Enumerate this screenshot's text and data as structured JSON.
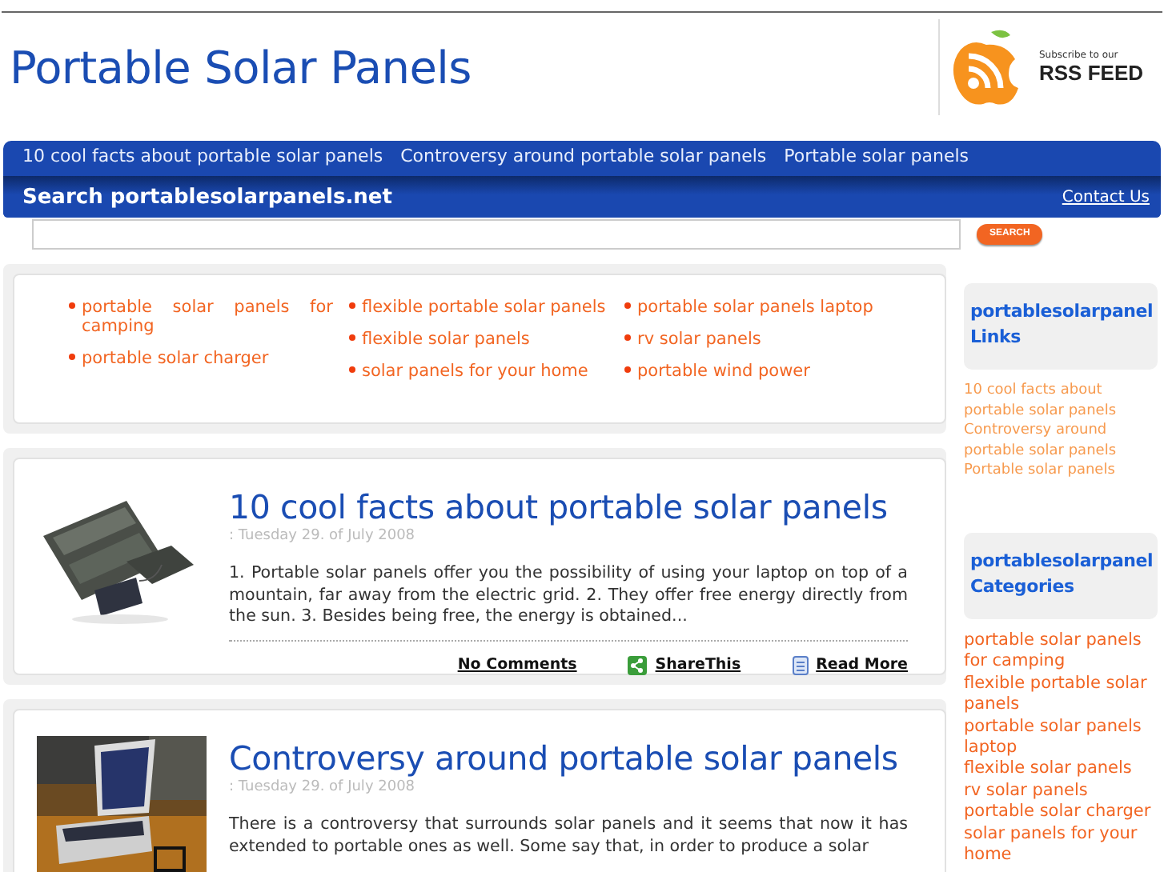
{
  "header": {
    "title": "Portable Solar Panels",
    "rss_small": "Subscribe to our",
    "rss_big": "RSS FEED"
  },
  "nav": {
    "links": [
      "10 cool facts about portable solar panels",
      "Controversy around portable solar panels",
      "Portable solar panels"
    ]
  },
  "search": {
    "label": "Search portablesolarpanels.net",
    "contact": "Contact Us",
    "button": "SEARCH"
  },
  "category_columns": [
    {
      "items": [
        "portable solar panels for camping",
        "portable solar charger"
      ]
    },
    {
      "items": [
        "flexible portable solar panels",
        "flexible solar panels",
        "solar panels for your home"
      ]
    },
    {
      "items": [
        "portable solar panels laptop",
        "rv solar panels",
        "portable wind power"
      ]
    }
  ],
  "posts": [
    {
      "title": "10 cool facts about portable solar panels",
      "date": ": Tuesday 29. of July 2008",
      "excerpt": "1. Portable solar panels offer you the possibility of using your laptop on top of a mountain, far away from the electric grid. 2. They offer free energy directly from the sun. 3. Besides being free, the energy is obtained...",
      "footer": {
        "comments": "No Comments",
        "share": "ShareThis",
        "read_more": "Read More"
      }
    },
    {
      "title": "Controversy around portable solar panels",
      "date": ": Tuesday 29. of July 2008",
      "excerpt": "There is a controversy that surrounds solar panels and it seems that now it has extended to portable ones as well. Some say that, in order to produce a solar"
    }
  ],
  "sidebar": [
    {
      "heading": "portablesolarpanel Links",
      "links": [
        "10 cool facts about portable solar panels",
        "Controversy around portable solar panels",
        "Portable solar panels"
      ]
    },
    {
      "heading": "portablesolarpanel Categories",
      "links": [
        "portable solar panels for camping",
        "flexible portable solar panels",
        "portable solar panels laptop",
        "flexible solar panels",
        "rv solar panels",
        "portable solar charger",
        "solar panels for your home"
      ]
    }
  ]
}
